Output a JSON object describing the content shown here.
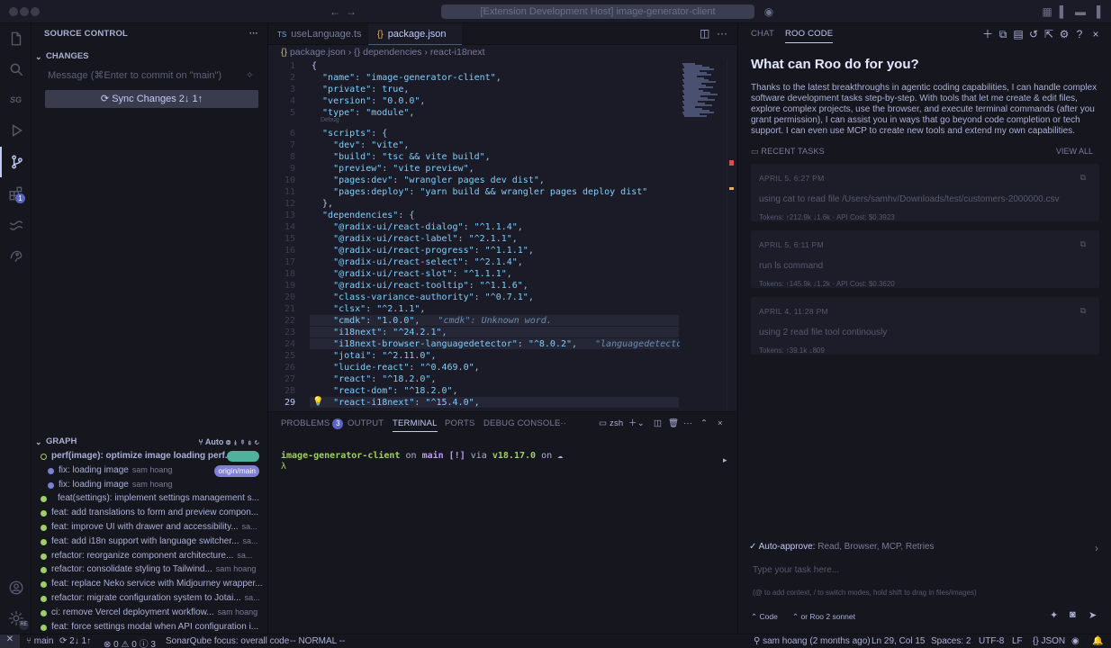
{
  "titlebar": {
    "command_center": "[Extension Development Host] image-generator-client"
  },
  "activity": {
    "extensions_badge": "1",
    "account_label": "RE"
  },
  "sidebar": {
    "title": "SOURCE CONTROL",
    "changes_title": "CHANGES",
    "commit_placeholder": "Message (⌘Enter to commit on \"main\")",
    "sync_label": "Sync Changes 2↓ 1↑",
    "graph_title": "GRAPH",
    "graph_auto": "Auto",
    "graph": [
      {
        "message": "perf(image): optimize image loading perf...",
        "author": "",
        "tag": ""
      },
      {
        "message": "fix: loading image",
        "author": "sam hoang",
        "tag": "origin/main"
      },
      {
        "message": "fix: loading image",
        "author": "sam hoang",
        "tag": ""
      },
      {
        "message": "feat(settings): implement settings management s...",
        "author": "",
        "tag": ""
      },
      {
        "message": "feat: add translations to form and preview compon...",
        "author": "",
        "tag": ""
      },
      {
        "message": "feat: improve UI with drawer and accessibility...",
        "author": "sa...",
        "tag": ""
      },
      {
        "message": "feat: add i18n support with language switcher...",
        "author": "sa...",
        "tag": ""
      },
      {
        "message": "refactor: reorganize component architecture...",
        "author": "sa...",
        "tag": ""
      },
      {
        "message": "refactor: consolidate styling to Tailwind...",
        "author": "sam hoang",
        "tag": ""
      },
      {
        "message": "feat: replace Neko service with Midjourney wrapper...",
        "author": "",
        "tag": ""
      },
      {
        "message": "refactor: migrate configuration system to Jotai...",
        "author": "sa...",
        "tag": ""
      },
      {
        "message": "ci: remove Vercel deployment workflow...",
        "author": "sam hoang",
        "tag": ""
      },
      {
        "message": "feat: force settings modal when API configuration i...",
        "author": "",
        "tag": ""
      }
    ]
  },
  "tabs": [
    {
      "label": "useLanguage.ts",
      "prefix": "TS"
    },
    {
      "label": "package.json",
      "prefix": "{}"
    }
  ],
  "breadcrumb": [
    "package.json",
    "{} dependencies",
    "react-i18next"
  ],
  "code_lines": [
    {
      "n": "1",
      "t": "{"
    },
    {
      "n": "2",
      "t": "  \"name\": \"image-generator-client\","
    },
    {
      "n": "3",
      "t": "  \"private\": true,"
    },
    {
      "n": "4",
      "t": "  \"version\": \"0.0.0\","
    },
    {
      "n": "5",
      "t": "  \"type\": \"module\","
    },
    {
      "n": "6",
      "t": "  \"scripts\": {"
    },
    {
      "n": "7",
      "t": "    \"dev\": \"vite\","
    },
    {
      "n": "8",
      "t": "    \"build\": \"tsc && vite build\","
    },
    {
      "n": "9",
      "t": "    \"preview\": \"vite preview\","
    },
    {
      "n": "10",
      "t": "    \"pages:dev\": \"wrangler pages dev dist\","
    },
    {
      "n": "11",
      "t": "    \"pages:deploy\": \"yarn build && wrangler pages deploy dist\""
    },
    {
      "n": "12",
      "t": "  },"
    },
    {
      "n": "13",
      "t": "  \"dependencies\": {"
    },
    {
      "n": "14",
      "t": "    \"@radix-ui/react-dialog\": \"^1.1.4\","
    },
    {
      "n": "15",
      "t": "    \"@radix-ui/react-label\": \"^2.1.1\","
    },
    {
      "n": "16",
      "t": "    \"@radix-ui/react-progress\": \"^1.1.1\","
    },
    {
      "n": "17",
      "t": "    \"@radix-ui/react-select\": \"^2.1.4\","
    },
    {
      "n": "18",
      "t": "    \"@radix-ui/react-slot\": \"^1.1.1\","
    },
    {
      "n": "19",
      "t": "    \"@radix-ui/react-tooltip\": \"^1.1.6\","
    },
    {
      "n": "20",
      "t": "    \"class-variance-authority\": \"^0.7.1\","
    },
    {
      "n": "21",
      "t": "    \"clsx\": \"^2.1.1\","
    },
    {
      "n": "22",
      "t": "    \"cmdk\": \"1.0.0\",",
      "w": "\"cmdk\": Unknown word."
    },
    {
      "n": "23",
      "t": "    \"i18next\": \"^24.2.1\","
    },
    {
      "n": "24",
      "t": "    \"i18next-browser-languagedetector\": \"^8.0.2\",",
      "w": "\"languagedetector\": Unknow"
    },
    {
      "n": "25",
      "t": "    \"jotai\": \"^2.11.0\","
    },
    {
      "n": "26",
      "t": "    \"lucide-react\": \"^0.469.0\","
    },
    {
      "n": "27",
      "t": "    \"react\": \"^18.2.0\","
    },
    {
      "n": "28",
      "t": "    \"react-dom\": \"^18.2.0\","
    },
    {
      "n": "29",
      "t": "    \"react-i18next\": \"^15.4.0\","
    }
  ],
  "codelens": "Debug",
  "panel": {
    "tabs": [
      "PROBLEMS",
      "OUTPUT",
      "TERMINAL",
      "PORTS",
      "DEBUG CONSOLE"
    ],
    "problems_count": "3",
    "shell": "zsh",
    "prompt_dir": "image-generator-client",
    "prompt_on": "on",
    "prompt_branch": "main [!]",
    "prompt_via": "via",
    "prompt_node": "v18.17.0",
    "prompt_on2": "on",
    "prompt_symbol": "λ"
  },
  "roo": {
    "tab_chat": "CHAT",
    "tab_roo": "ROO CODE",
    "title": "What can Roo do for you?",
    "description": "Thanks to the latest breakthroughs in agentic coding capabilities, I can handle complex software development tasks step-by-step. With tools that let me create & edit files, explore complex projects, use the browser, and execute terminal commands (after you grant permission), I can assist you in ways that go beyond code completion or tech support. I can even use MCP to create new tools and extend my own capabilities.",
    "recent_title": "RECENT TASKS",
    "view_all": "VIEW ALL",
    "tasks": [
      {
        "date": "APRIL 5, 6:27 PM",
        "text": "using cat to read file /Users/samhv/Downloads/test/customers-2000000.csv",
        "tokens": "Tokens: ↑212.9k ↓1.6k · API Cost: $0.3923"
      },
      {
        "date": "APRIL 5, 6:11 PM",
        "text": "run ls command",
        "tokens": "Tokens: ↑145.9k ↓1.2k · API Cost: $0.3620"
      },
      {
        "date": "APRIL 4, 11:28 PM",
        "text": "using 2 read file tool continously",
        "tokens": "Tokens: ↑39.1k ↓809"
      }
    ],
    "auto_approve_label": "Auto-approve:",
    "auto_approve_value": "Read, Browser, MCP, Retries",
    "input_placeholder": "Type your task here...",
    "input_hint": "(@ to add context, / to switch modes, hold shift to drag in files/images)",
    "mode": "Code",
    "model": "or Roo 2 sonnet"
  },
  "status": {
    "branch": "main",
    "sync": "2↓ 1↑",
    "problems": "⊗ 0 ⚠ 0 ⓘ 3",
    "sonar": "SonarQube focus: overall code",
    "vim": "-- NORMAL --",
    "blame": "sam hoang (2 months ago)",
    "position": "Ln 29, Col 15",
    "spaces": "Spaces: 2",
    "encoding": "UTF-8",
    "eol": "LF",
    "language": "{} JSON"
  },
  "colors": {
    "accent": "#5a63c6",
    "string": "#9ece6a",
    "key": "#7dcfff",
    "background": "#1a1b26",
    "branch_tag": "#7f7fd5"
  }
}
